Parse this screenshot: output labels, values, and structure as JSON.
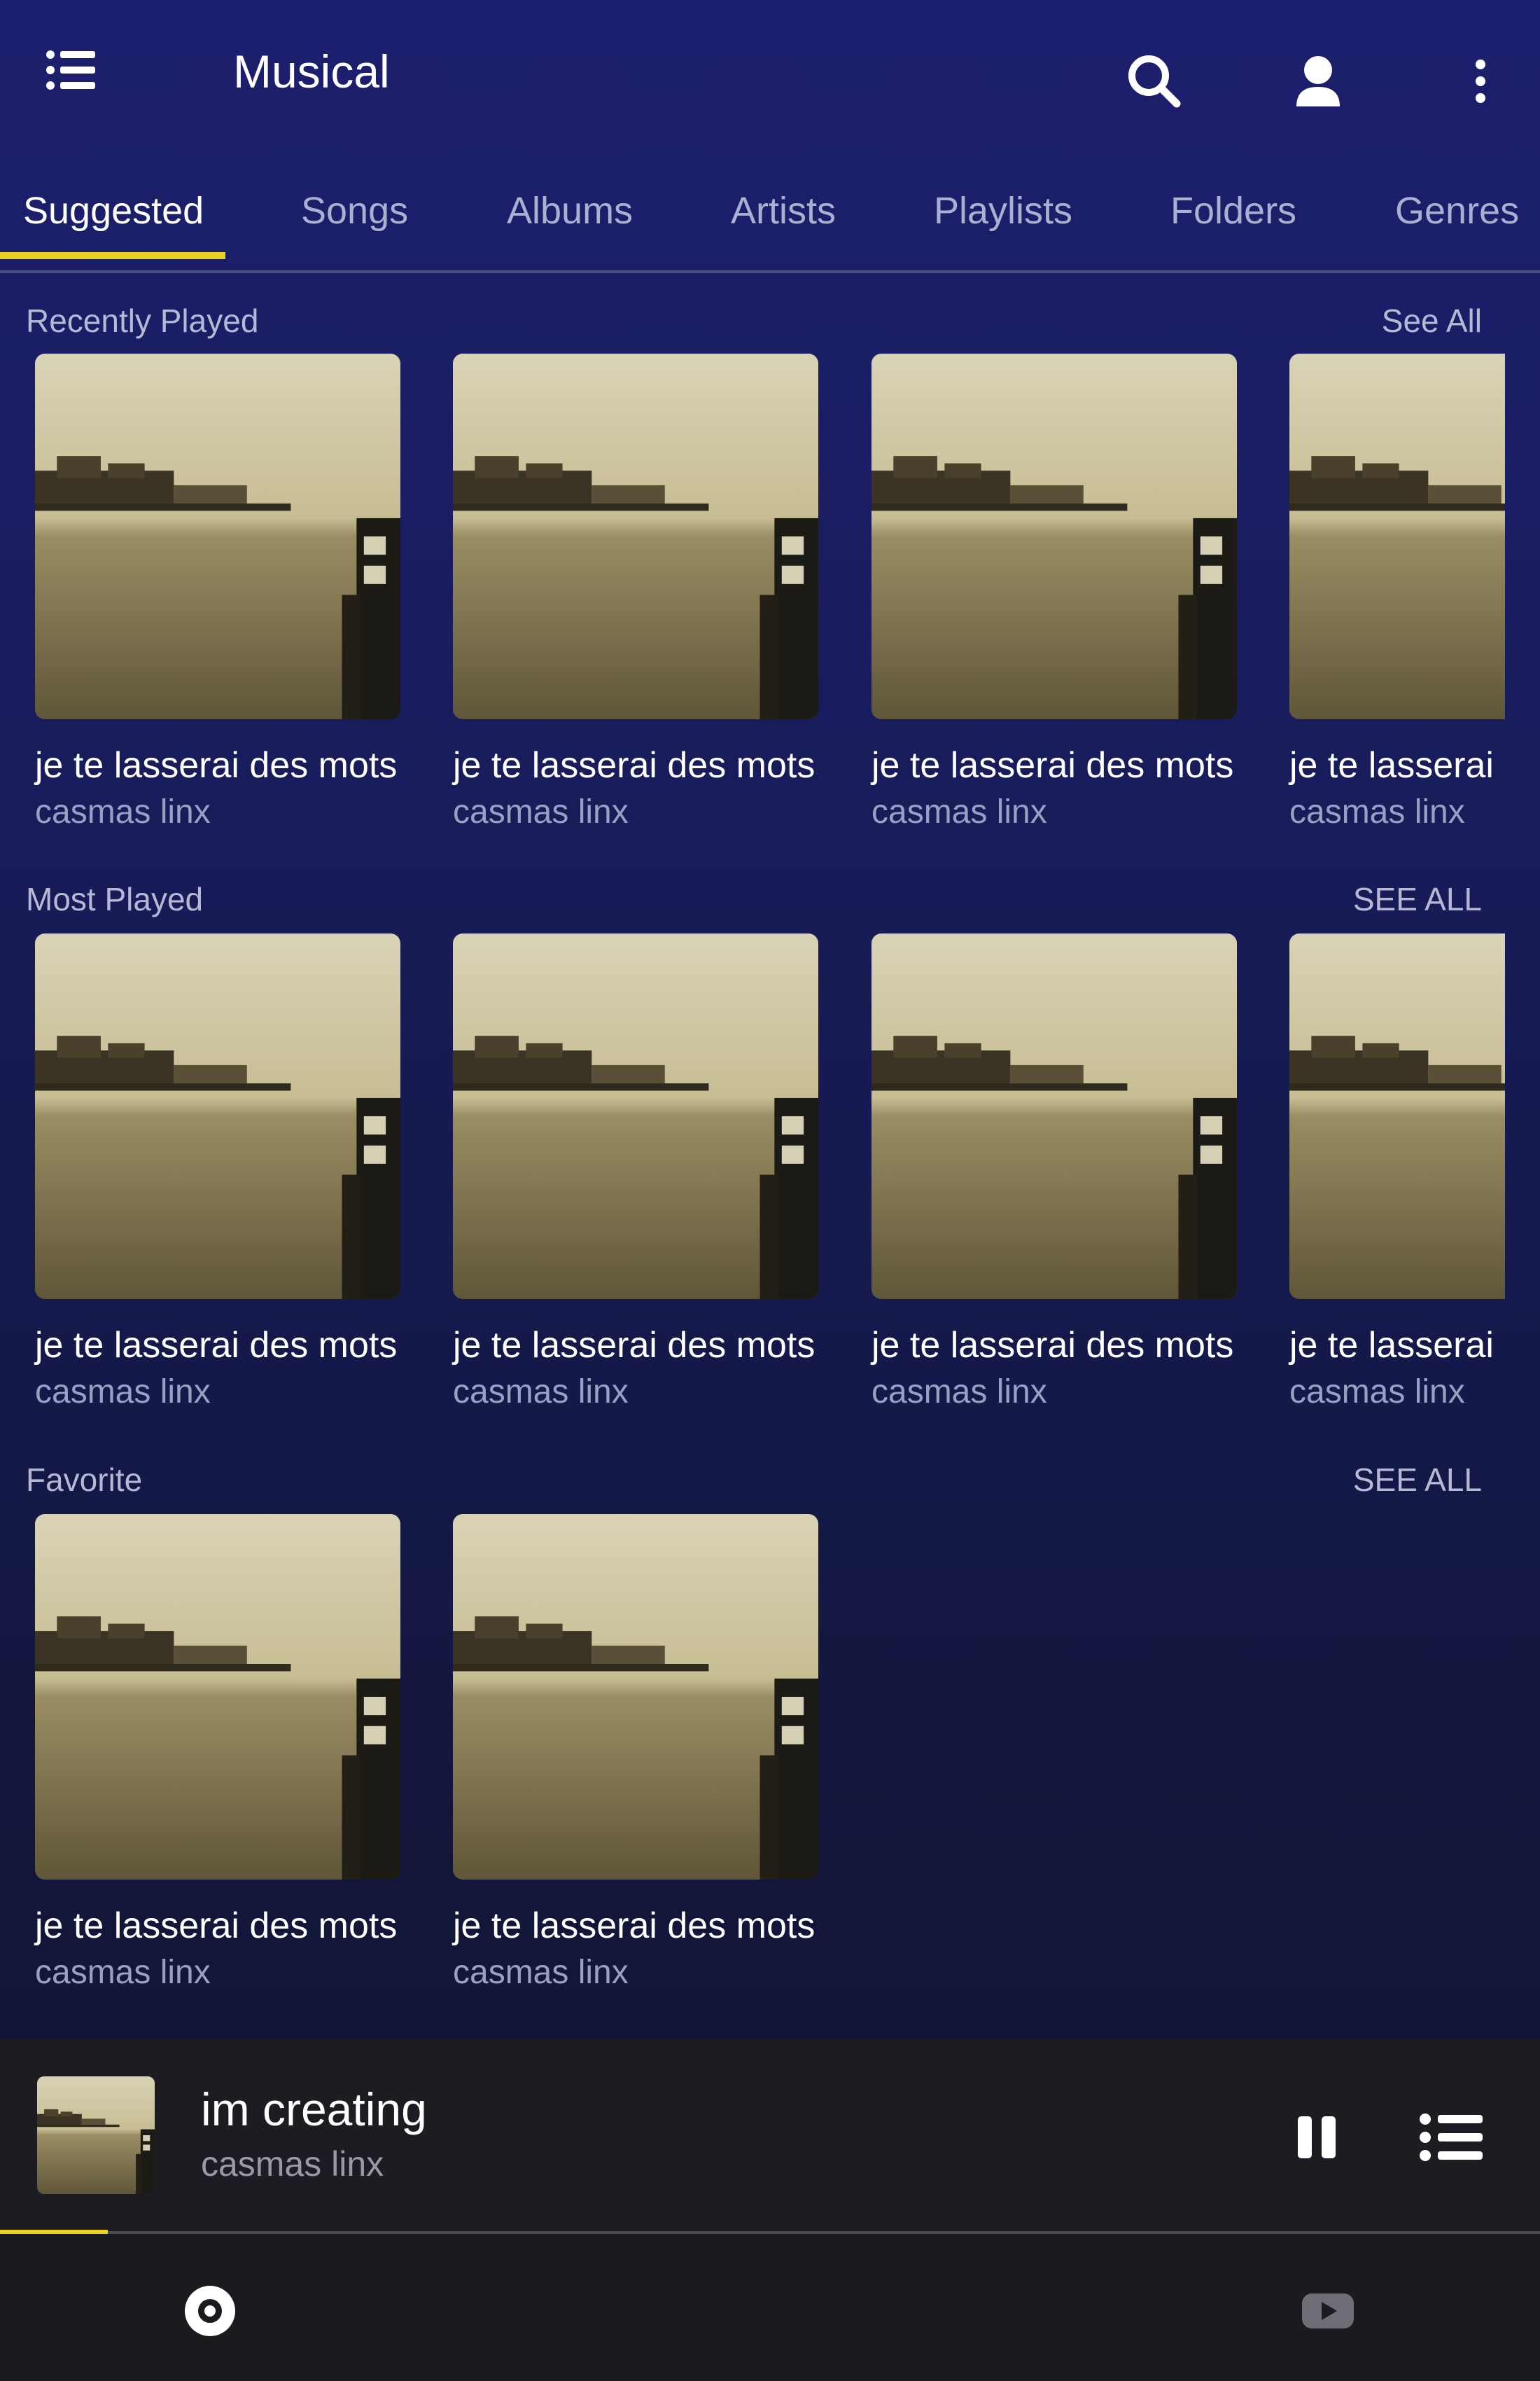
{
  "app": {
    "title": "Musical"
  },
  "appbar": {
    "menu_icon": "list-menu-icon",
    "search_icon": "search-icon",
    "account_icon": "account-icon",
    "more_icon": "more-vert-icon"
  },
  "tabs": [
    {
      "label": "Suggested",
      "active": true
    },
    {
      "label": "Songs",
      "active": false
    },
    {
      "label": "Albums",
      "active": false
    },
    {
      "label": "Artists",
      "active": false
    },
    {
      "label": "Playlists",
      "active": false
    },
    {
      "label": "Folders",
      "active": false
    },
    {
      "label": "Genres",
      "active": false
    }
  ],
  "colors": {
    "accent": "#e8d21e",
    "background_top": "#1c1f6e",
    "background_bottom": "#0f1330",
    "player_bg": "#1c1c22"
  },
  "sections": [
    {
      "title": "Recently Played",
      "see_all": "See All",
      "items": [
        {
          "title": "je te lasserai des mots",
          "artist": "casmas linx"
        },
        {
          "title": "je te lasserai des mots",
          "artist": "casmas linx"
        },
        {
          "title": "je te lasserai des mots",
          "artist": "casmas linx"
        },
        {
          "title": "je te lasserai des mots",
          "artist": "casmas linx"
        }
      ]
    },
    {
      "title": "Most Played",
      "see_all": "SEE ALL",
      "items": [
        {
          "title": "je te lasserai des mots",
          "artist": "casmas linx"
        },
        {
          "title": "je te lasserai des mots",
          "artist": "casmas linx"
        },
        {
          "title": "je te lasserai des mots",
          "artist": "casmas linx"
        },
        {
          "title": "je te lasserai des mots",
          "artist": "casmas linx"
        }
      ]
    },
    {
      "title": "Favorite",
      "see_all": "SEE ALL",
      "items": [
        {
          "title": "je te lasserai des mots",
          "artist": "casmas linx"
        },
        {
          "title": "je te lasserai des mots",
          "artist": "casmas linx"
        }
      ]
    }
  ],
  "now_playing": {
    "title": "im creating",
    "artist": "casmas linx",
    "progress": 0.07,
    "pause_icon": "pause-icon",
    "queue_icon": "queue-list-icon"
  },
  "bottom_nav": [
    {
      "icon": "disc-icon",
      "active": true
    },
    {
      "icon": "youtube-icon",
      "active": false
    }
  ]
}
